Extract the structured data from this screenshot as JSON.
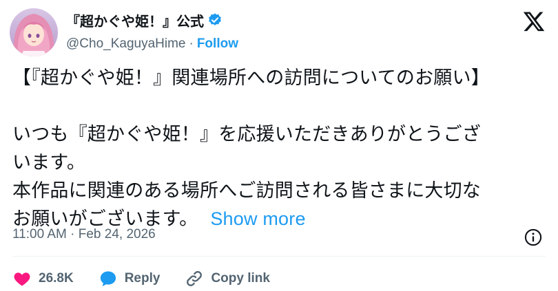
{
  "author": {
    "display_name": "『超かぐや姫！』公式",
    "handle": "@Cho_KaguyaHime",
    "separator": "·",
    "follow_label": "Follow",
    "verified": true
  },
  "icons": {
    "avatar": "avatar",
    "verified": "verified-badge-icon",
    "logo": "x-logo-icon",
    "info": "info-icon",
    "like": "heart-icon",
    "reply": "speech-bubble-icon",
    "copy": "link-icon"
  },
  "tweet": {
    "lines": [
      "【『超かぐや姫！』関連場所への訪問についてのお願い】",
      "",
      "いつも『超かぐや姫！』を応援いただきありがとうござ",
      "います。",
      "本作品に関連のある場所へご訪問される皆さまに大切な",
      "お願いがございます。"
    ],
    "show_more_label": "Show more"
  },
  "timestamp": "11:00 AM · Feb 24, 2026",
  "actions": {
    "like_count": "26.8K",
    "reply_label": "Reply",
    "copy_link_label": "Copy link"
  },
  "colors": {
    "accent": "#1d9bf0",
    "like": "#f91880",
    "muted": "#536471",
    "text": "#0f1419"
  }
}
